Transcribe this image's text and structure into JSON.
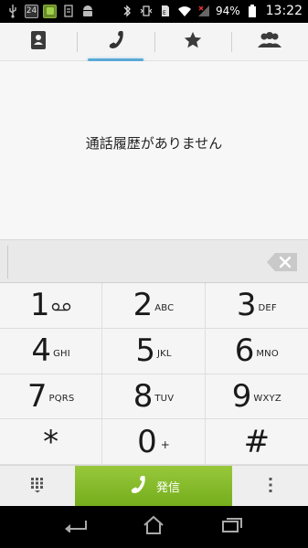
{
  "status_bar": {
    "left_icons": [
      "usb-icon",
      "calendar-icon",
      "app-icon",
      "usb-debug-icon",
      "android-icon"
    ],
    "calendar_day": "24",
    "battery_percent": "94%",
    "time": "13:22"
  },
  "tabs": [
    {
      "name": "contacts",
      "icon": "contacts-book-icon"
    },
    {
      "name": "phone",
      "icon": "phone-handset-icon",
      "active": true
    },
    {
      "name": "favorites",
      "icon": "star-icon"
    },
    {
      "name": "groups",
      "icon": "people-icon"
    }
  ],
  "call_log": {
    "empty_message": "通話履歴がありません"
  },
  "keypad": {
    "keys": [
      {
        "digit": "1",
        "sub": "",
        "icon": "voicemail-icon"
      },
      {
        "digit": "2",
        "sub": "ABC"
      },
      {
        "digit": "3",
        "sub": "DEF"
      },
      {
        "digit": "4",
        "sub": "GHI"
      },
      {
        "digit": "5",
        "sub": "JKL"
      },
      {
        "digit": "6",
        "sub": "MNO"
      },
      {
        "digit": "7",
        "sub": "PQRS"
      },
      {
        "digit": "8",
        "sub": "TUV"
      },
      {
        "digit": "9",
        "sub": "WXYZ"
      },
      {
        "digit": "*",
        "sub": ""
      },
      {
        "digit": "0",
        "sub": "+"
      },
      {
        "digit": "#",
        "sub": ""
      }
    ]
  },
  "actions": {
    "call_label": "発信"
  },
  "colors": {
    "accent_tab": "#5aa9d6",
    "call_green": "#7fb52a"
  }
}
